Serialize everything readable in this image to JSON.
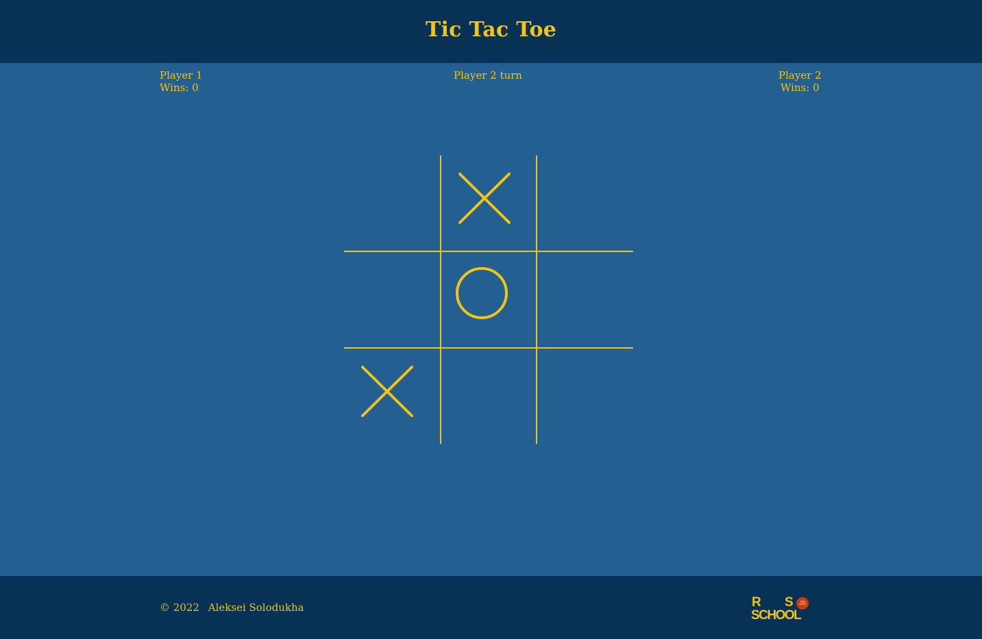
{
  "header": {
    "title": "Tic Tac Toe"
  },
  "players": {
    "left": {
      "name": "Player 1",
      "wins": "Wins: 0"
    },
    "right": {
      "name": "Player 2",
      "wins": "Wins: 0"
    }
  },
  "status": {
    "turn": "Player 2 turn"
  },
  "board": {
    "cells": [
      "",
      "X",
      "",
      "",
      "O",
      "",
      "X",
      "",
      ""
    ]
  },
  "footer": {
    "copyright_symbol": "©",
    "year": "2022",
    "author": "Aleksei Solodukha",
    "logo": {
      "line1_a": "R",
      "line1_b": "S",
      "line2": "SCHOOL",
      "badge": "JS"
    }
  },
  "colors": {
    "accent": "#f2c318",
    "header_bg": "#073256",
    "main_bg": "#236091",
    "badge": "#c83a1f"
  }
}
